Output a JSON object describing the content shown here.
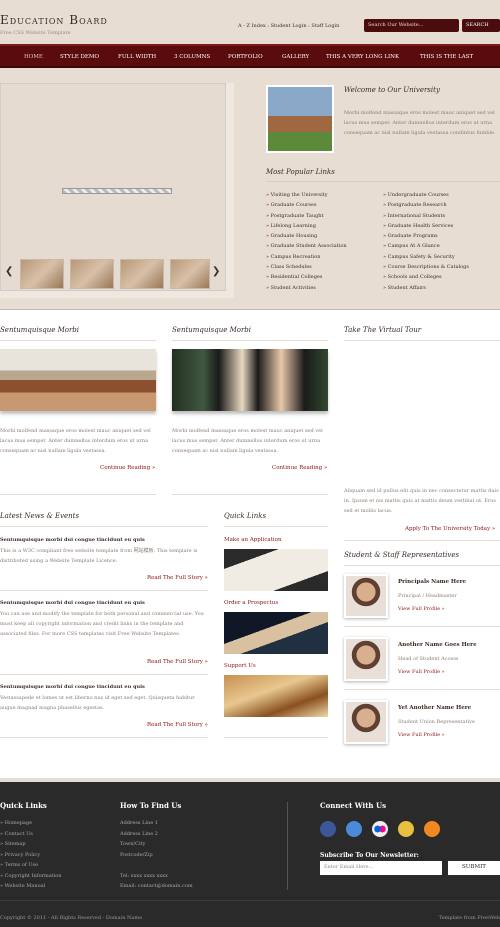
{
  "header": {
    "logo": "Education Board",
    "tagline": "Free CSS Website Template",
    "toplinks": "A - Z Index : Student Login : Staff Login",
    "search_placeholder": "Search Our Website...",
    "search_button": "Search"
  },
  "nav": [
    "Home",
    "Style Demo",
    "Full Width",
    "3 Columns",
    "Portfolio",
    "Gallery",
    "This a very long link",
    "This is the last"
  ],
  "feature": {
    "welcome_title": "Welcome to Our University",
    "welcome_text": "Morbi molfend massaque eros molest mauc aniquet sed vel lacus mus semper. Anter dumnellus interdum eros ut urna consequam ac nisl nullam ligula vestassa condintus fumble.",
    "popular_title": "Most Popular Links",
    "links_left": [
      "Visiting the University",
      "Graduate Courses",
      "Postgraduate Taught",
      "Lifelong Learning",
      "Graduate Housing",
      "Graduate Student Association",
      "Campus Recreation",
      "Class Schedules",
      "Residential Colleges",
      "Student Activities"
    ],
    "links_right": [
      "Undergraduate Courses",
      "Postgraduate Research",
      "International Students",
      "Graduate Health Services",
      "Graduate Programs",
      "Campus At A Glance",
      "Campus Safety & Security",
      "Course Descriptions & Catalogs",
      "Schools and Colleges",
      "Student Affairs"
    ]
  },
  "sections": {
    "col1_title": "Sentumquisque Morbi",
    "col2_title": "Sentumquisque Morbi",
    "col3_title": "Take The Virtual Tour",
    "col_text": "Morbi molfend massaque eros molest mauc aniquet sed vel lacus mus semper. Anter dumnellus interdum eros ut urna consequam ac nisl nullam ligula vestassa.",
    "continue": "Continue Reading »",
    "tour_text": "Aliquam sed id pullus elit quis in nec consectetur mattis duis in. Ipsum et nis mattis quis at mattis deum vestibul ut. Eros sed et mollis lacus.",
    "tour_link": "Apply To The University Today »"
  },
  "news": {
    "title": "Latest News & Events",
    "items": [
      {
        "head": "Sentumquisque morbi dui congue tincidunt eu quis",
        "text": "This is a W3C compliant free website template from 网站模板. This template is distributed using a Website Template Licence.",
        "more": "Read The Full Story »"
      },
      {
        "head": "Sentumquisque morbi dui congue tincidunt eu quis",
        "text": "You can use and modify the template for both personal and commercial use. You must keep all copyright information and credit links in the template and associated files. For more CSS templates visit Free Website Templates.",
        "more": "Read The Full Story »"
      },
      {
        "head": "Sentumquisque morbi dui congue tincidunt eu quis",
        "text": "Vestassapede et lomes ut est liberno nus id eget sed eget. Quisqueta habitur augue magnad magna phasellus egestas.",
        "more": "Read The Full Story »"
      }
    ]
  },
  "quick": {
    "title": "Quick Links",
    "items": [
      "Make an Application",
      "Order a Prospectus",
      "Support Us"
    ]
  },
  "reps": {
    "title": "Student & Staff Representatives",
    "items": [
      {
        "name": "Principals Name Here",
        "role": "Principal / Headmaster",
        "link": "View Full Profile »"
      },
      {
        "name": "Another Name Goes Here",
        "role": "Head of Student Access",
        "link": "View Full Profile »"
      },
      {
        "name": "Yet Another Name Here",
        "role": "Student Union Representative",
        "link": "View Full Profile »"
      }
    ]
  },
  "footer": {
    "quick_title": "Quick Links",
    "quick_items": [
      "» Homepage",
      "» Contact Us",
      "» Sitemap",
      "» Privacy Policy",
      "» Terms of Use",
      "» Copyright Information",
      "» Website Manual"
    ],
    "find_title": "How To Find Us",
    "find_items": [
      "Address Line 1",
      "Address Line 2",
      "Town/City",
      "Postcode/Zip",
      "",
      "Tel: xxxx xxxx xxxx",
      "Email: contact@domain.com"
    ],
    "connect_title": "Connect With Us",
    "subscribe_title": "Subscribe To Our Newsletter:",
    "email_placeholder": "Enter Email Here...",
    "submit": "Submit",
    "copyright": "Copyright © 2011 - All Rights Reserved - Domain Name",
    "template_from": "Template from FreeWeb"
  }
}
